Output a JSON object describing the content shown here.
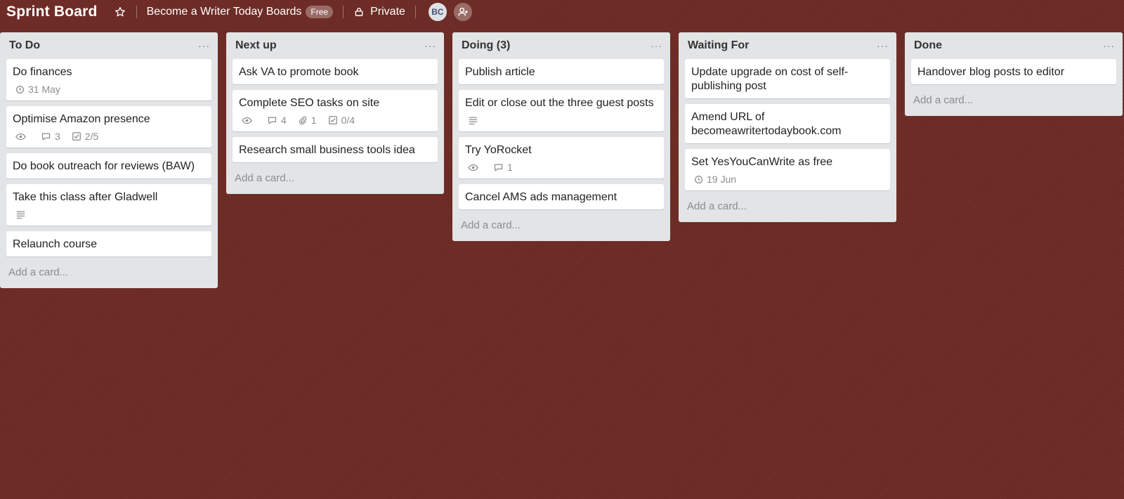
{
  "header": {
    "board_title": "Sprint Board",
    "team_name": "Become a Writer Today Boards",
    "plan_badge": "Free",
    "privacy": "Private",
    "avatar_initials": "BC"
  },
  "add_card_label": "Add a card...",
  "lists": [
    {
      "title": "To Do",
      "menu": "···",
      "cards": [
        {
          "title": "Do finances",
          "due": "31 May"
        },
        {
          "title": "Optimise Amazon presence",
          "comments": "3",
          "checklist": "2/5"
        },
        {
          "title": "Do book outreach for reviews (BAW)"
        },
        {
          "title": "Take this class after Gladwell"
        },
        {
          "title": "Relaunch course"
        }
      ]
    },
    {
      "title": "Next up",
      "menu": "···",
      "cards": [
        {
          "title": "Ask VA to promote book"
        },
        {
          "title": "Complete SEO tasks on site",
          "comments": "4",
          "attachments": "1",
          "checklist": "0/4"
        },
        {
          "title": "Research small business tools idea"
        }
      ]
    },
    {
      "title": "Doing (3)",
      "menu": "···",
      "cards": [
        {
          "title": "Publish article"
        },
        {
          "title": "Edit or close out the three guest posts"
        },
        {
          "title": "Try YoRocket",
          "comments": "1"
        },
        {
          "title": "Cancel AMS ads management"
        }
      ]
    },
    {
      "title": "Waiting For",
      "menu": "···",
      "cards": [
        {
          "title": "Update upgrade on cost of self-publishing post"
        },
        {
          "title": "Amend URL of becomeawritertodaybook.com"
        },
        {
          "title": "Set YesYouCanWrite as free",
          "due": "19 Jun"
        }
      ]
    },
    {
      "title": "Done",
      "menu": "···",
      "cards": [
        {
          "title": "Handover blog posts to editor"
        }
      ]
    }
  ]
}
